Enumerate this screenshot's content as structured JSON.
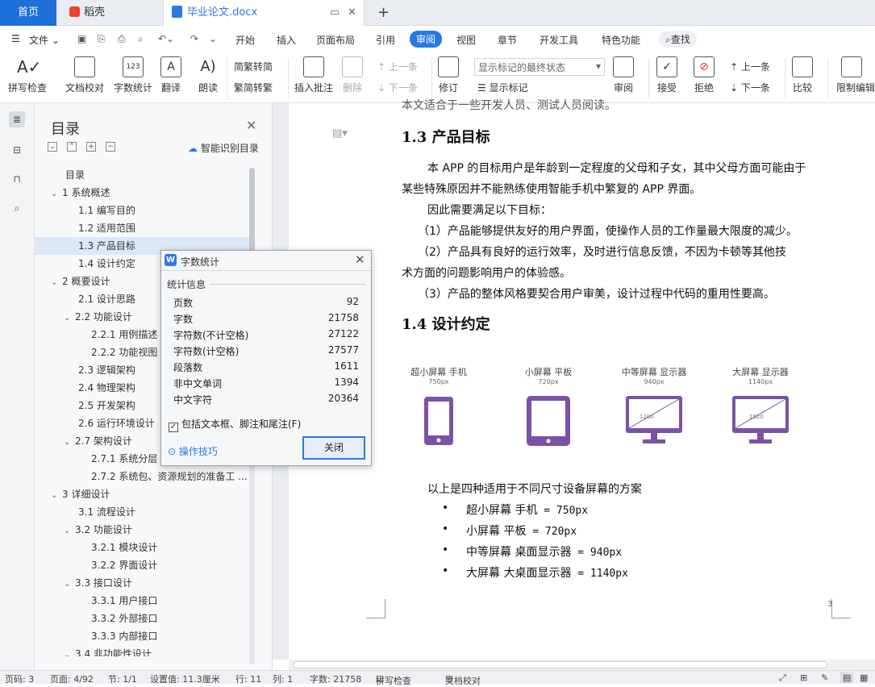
{
  "tabs": {
    "home": "首页",
    "daoke": "稻壳",
    "doc": "毕业论文.docx",
    "add": "+"
  },
  "menubar": {
    "file": "文件",
    "items": [
      "开始",
      "插入",
      "页面布局",
      "引用",
      "审阅",
      "视图",
      "章节",
      "开发工具",
      "特色功能"
    ],
    "active": "审阅",
    "search": "查找"
  },
  "ribbon": {
    "spell": "拼写检查",
    "proof": "文档校对",
    "wordcount": "字数统计",
    "translate": "翻译",
    "read": "朗读",
    "to_trad": "繁转简",
    "to_simp": "简转繁",
    "insert_comment": "插入批注",
    "delete": "删除",
    "prev_comment": "上一条",
    "next_comment": "下一条",
    "revise": "修订",
    "markup_select": "显示标记的最终状态",
    "show_markup": "显示标记",
    "review": "审阅",
    "accept": "接受",
    "reject": "拒绝",
    "prev_change": "上一条",
    "next_change": "下一条",
    "compare": "比较",
    "restrict": "限制编辑"
  },
  "toc": {
    "title": "目录",
    "smart": "智能识别目录",
    "items": [
      {
        "text": "目录",
        "level": 0,
        "caret": ""
      },
      {
        "text": "1  系统概述",
        "level": 0,
        "caret": "v"
      },
      {
        "text": "1.1 编写目的",
        "level": 1,
        "caret": ""
      },
      {
        "text": "1.2 适用范围",
        "level": 1,
        "caret": ""
      },
      {
        "text": "1.3 产品目标",
        "level": 1,
        "caret": "",
        "selected": true
      },
      {
        "text": "1.4 设计约定",
        "level": 1,
        "caret": ""
      },
      {
        "text": "2  概要设计",
        "level": 0,
        "caret": "v"
      },
      {
        "text": "2.1 设计思路",
        "level": 1,
        "caret": ""
      },
      {
        "text": "2.2 功能设计",
        "level": 1,
        "caret": "v"
      },
      {
        "text": "2.2.1 用例描述",
        "level": 2,
        "caret": ""
      },
      {
        "text": "2.2.2 功能视图",
        "level": 2,
        "caret": ""
      },
      {
        "text": "2.3 逻辑架构",
        "level": 1,
        "caret": ""
      },
      {
        "text": "2.4  物理架构",
        "level": 1,
        "caret": ""
      },
      {
        "text": "2.5 开发架构",
        "level": 1,
        "caret": ""
      },
      {
        "text": "2.6 运行环境设计",
        "level": 1,
        "caret": ""
      },
      {
        "text": "2.7 架构设计",
        "level": 1,
        "caret": "v"
      },
      {
        "text": "2.7.1 系统分层",
        "level": 2,
        "caret": ""
      },
      {
        "text": "2.7.2 系统包、资源规划的准备工 ...",
        "level": 2,
        "caret": ""
      },
      {
        "text": "3  详细设计",
        "level": 0,
        "caret": "v"
      },
      {
        "text": "3.1  流程设计",
        "level": 1,
        "caret": ""
      },
      {
        "text": "3.2 功能设计",
        "level": 1,
        "caret": "v"
      },
      {
        "text": "3.2.1 模块设计",
        "level": 2,
        "caret": ""
      },
      {
        "text": "3.2.2 界面设计",
        "level": 2,
        "caret": ""
      },
      {
        "text": "3.3 接口设计",
        "level": 1,
        "caret": "v"
      },
      {
        "text": "3.3.1 用户接口",
        "level": 2,
        "caret": ""
      },
      {
        "text": "3.3.2 外部接口",
        "level": 2,
        "caret": ""
      },
      {
        "text": "3.3.3 内部接口",
        "level": 2,
        "caret": ""
      },
      {
        "text": "3.4 非功能性设计",
        "level": 1,
        "caret": "v"
      }
    ]
  },
  "doc": {
    "top_cut": "本文适合于一些开发人员、测试人员阅读。",
    "h13": "1.3 产品目标",
    "p1a": "本 APP 的目标用户是年龄到一定程度的父母和子女，其中父母方面可能由于",
    "p1b": "某些特殊原因并不能熟练使用智能手机中繁复的 APP 界面。",
    "p2": "因此需要满足以下目标：",
    "p3": "（1）产品能够提供友好的用户界面，使操作人员的工作量最大限度的减少。",
    "p4a": "（2）产品具有良好的运行效率，及时进行信息反馈，不因为卡顿等其他技",
    "p4b": "术方面的问题影响用户的体验感。",
    "p5": "（3）产品的整体风格要契合用户审美，设计过程中代码的重用性要高。",
    "h14": "1.4 设计约定",
    "devices": [
      {
        "label": "超小屏幕 手机",
        "size": "750px"
      },
      {
        "label": "小屏幕 平板",
        "size": "720px"
      },
      {
        "label": "中等屏幕 显示器",
        "size": "940px",
        "screen": "1200"
      },
      {
        "label": "大屏幕 显示器",
        "size": "1140px",
        "screen": "1920"
      }
    ],
    "p6": "以上是四种适用于不同尺寸设备屏幕的方案",
    "bullets": [
      {
        "a": "超小屏幕 手机",
        "b": " = 750px"
      },
      {
        "a": "小屏幕 平板",
        "b": " = 720px"
      },
      {
        "a": "中等屏幕 桌面显示器",
        "b": " = 940px"
      },
      {
        "a": "大屏幕 大桌面显示器",
        "b": " = 1140px"
      }
    ],
    "page_num": "3",
    "bullet_char": "•"
  },
  "dialog": {
    "title": "字数统计",
    "section": "统计信息",
    "rows": [
      {
        "k": "页数",
        "v": "92"
      },
      {
        "k": "字数",
        "v": "21758"
      },
      {
        "k": "字符数(不计空格)",
        "v": "27122"
      },
      {
        "k": "字符数(计空格)",
        "v": "27577"
      },
      {
        "k": "段落数",
        "v": "1611"
      },
      {
        "k": "非中文单词",
        "v": "1394"
      },
      {
        "k": "中文字符",
        "v": "20364"
      }
    ],
    "checkbox": "包括文本框、脚注和尾注(F)",
    "tips": "操作技巧",
    "close_btn": "关闭"
  },
  "status": {
    "page_no": "页码: 3",
    "pages": "页面: 4/92",
    "section": "节: 1/1",
    "setting": "设置值: 11.3厘米",
    "row": "行: 11",
    "col": "列: 1",
    "words": "字数: 21758",
    "spell": "拼写检查",
    "proof": "文档校对"
  },
  "colors": {
    "accent": "#2b78e4",
    "purple": "#7b52a6",
    "tab_home": "#1e6fd9"
  }
}
